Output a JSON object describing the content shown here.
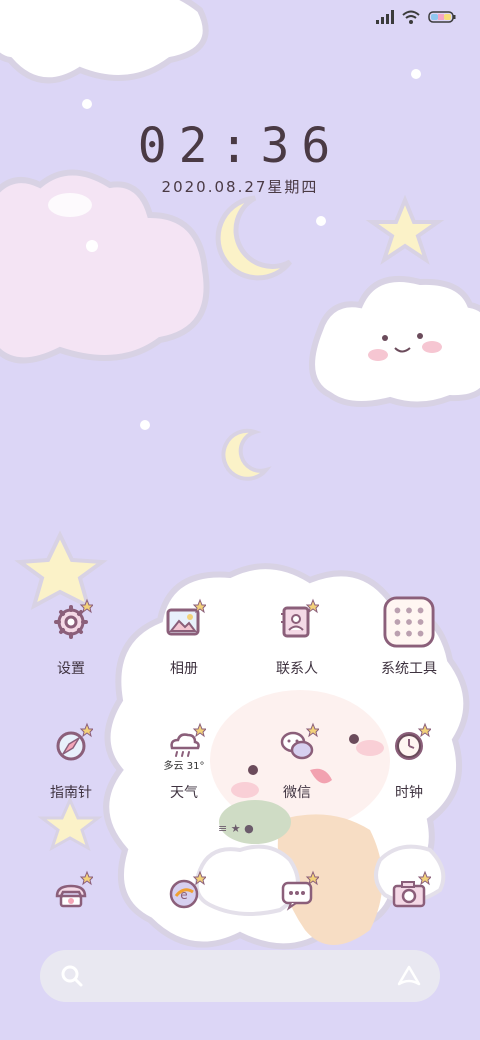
{
  "lockscreen": {
    "time": "02:36",
    "date": "2020.08.27星期四"
  },
  "apps_row1": [
    {
      "label": "设置",
      "icon": "gear-icon"
    },
    {
      "label": "相册",
      "icon": "gallery-icon"
    },
    {
      "label": "联系人",
      "icon": "contacts-icon"
    },
    {
      "label": "系统工具",
      "icon": "system-tools-folder-icon"
    }
  ],
  "apps_row2": [
    {
      "label": "指南针",
      "icon": "compass-icon"
    },
    {
      "label": "天气",
      "icon": "weather-icon",
      "badge": "多云 31°"
    },
    {
      "label": "微信",
      "icon": "wechat-icon"
    },
    {
      "label": "时钟",
      "icon": "clock-icon"
    }
  ],
  "dock": [
    {
      "icon": "phone-icon"
    },
    {
      "icon": "browser-icon"
    },
    {
      "icon": "messages-icon"
    },
    {
      "icon": "camera-icon"
    }
  ],
  "colors": {
    "background": "#dcd6f6",
    "outline": "#8b5f7a",
    "accent": "#f3d27a"
  }
}
